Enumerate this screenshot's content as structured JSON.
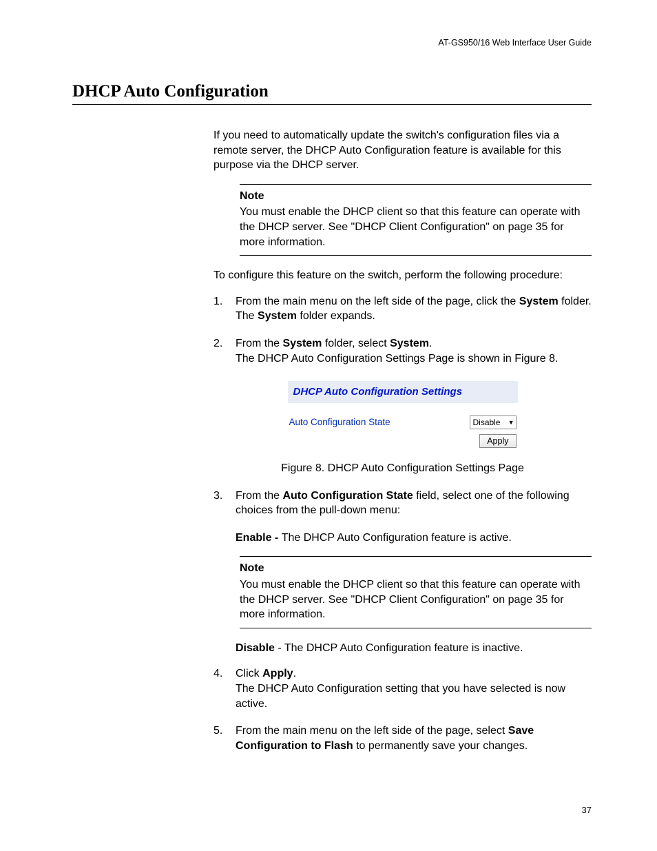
{
  "header": {
    "guide_title": "AT-GS950/16  Web Interface User Guide"
  },
  "title": "DHCP Auto Configuration",
  "intro": "If you need to automatically update the switch's configuration files via a remote server, the DHCP Auto Configuration feature is available for this purpose via the DHCP server.",
  "note1": {
    "label": "Note",
    "body": "You must enable the DHCP client so that this feature can operate with the DHCP server. See \"DHCP Client Configuration\" on page 35 for more information."
  },
  "procedure_intro": "To configure this feature on the switch, perform the following procedure:",
  "steps": {
    "s1": {
      "num": "1.",
      "l1a": "From the main menu on the left side of the page, click the ",
      "l1b": "System",
      "l1c": " folder.",
      "l2a": "The ",
      "l2b": "System",
      "l2c": " folder expands."
    },
    "s2": {
      "num": "2.",
      "l1a": "From the ",
      "l1b": "System",
      "l1c": " folder, select ",
      "l1d": "System",
      "l1e": ".",
      "l2": "The DHCP Auto Configuration Settings Page is shown in Figure 8."
    },
    "s3": {
      "num": "3.",
      "l1a": "From the ",
      "l1b": "Auto Configuration State",
      "l1c": " field, select one of the following choices from the pull-down menu:"
    },
    "s4": {
      "num": "4.",
      "l1a": "Click ",
      "l1b": "Apply",
      "l1c": ".",
      "l2": "The DHCP Auto Configuration setting that you have selected is now active."
    },
    "s5": {
      "num": "5.",
      "l1a": "From the main menu on the left side of the page, select ",
      "l1b": "Save Configuration to Flash",
      "l1c": " to permanently save your changes."
    }
  },
  "enable_line": {
    "a": "Enable - ",
    "b": "The DHCP Auto Configuration feature is active."
  },
  "note2": {
    "label": "Note",
    "body": "You must enable the DHCP client so that this feature can operate with the DHCP server. See \"DHCP Client Configuration\" on page 35 for more information."
  },
  "disable_line": {
    "a": "Disable",
    "b": " - The DHCP Auto Configuration feature is inactive."
  },
  "figure": {
    "panel_title": "DHCP Auto Configuration Settings",
    "field_label": "Auto Configuration State",
    "dropdown_value": "Disable",
    "apply_label": "Apply",
    "caption": "Figure 8. DHCP Auto Configuration Settings Page"
  },
  "page_number": "37"
}
